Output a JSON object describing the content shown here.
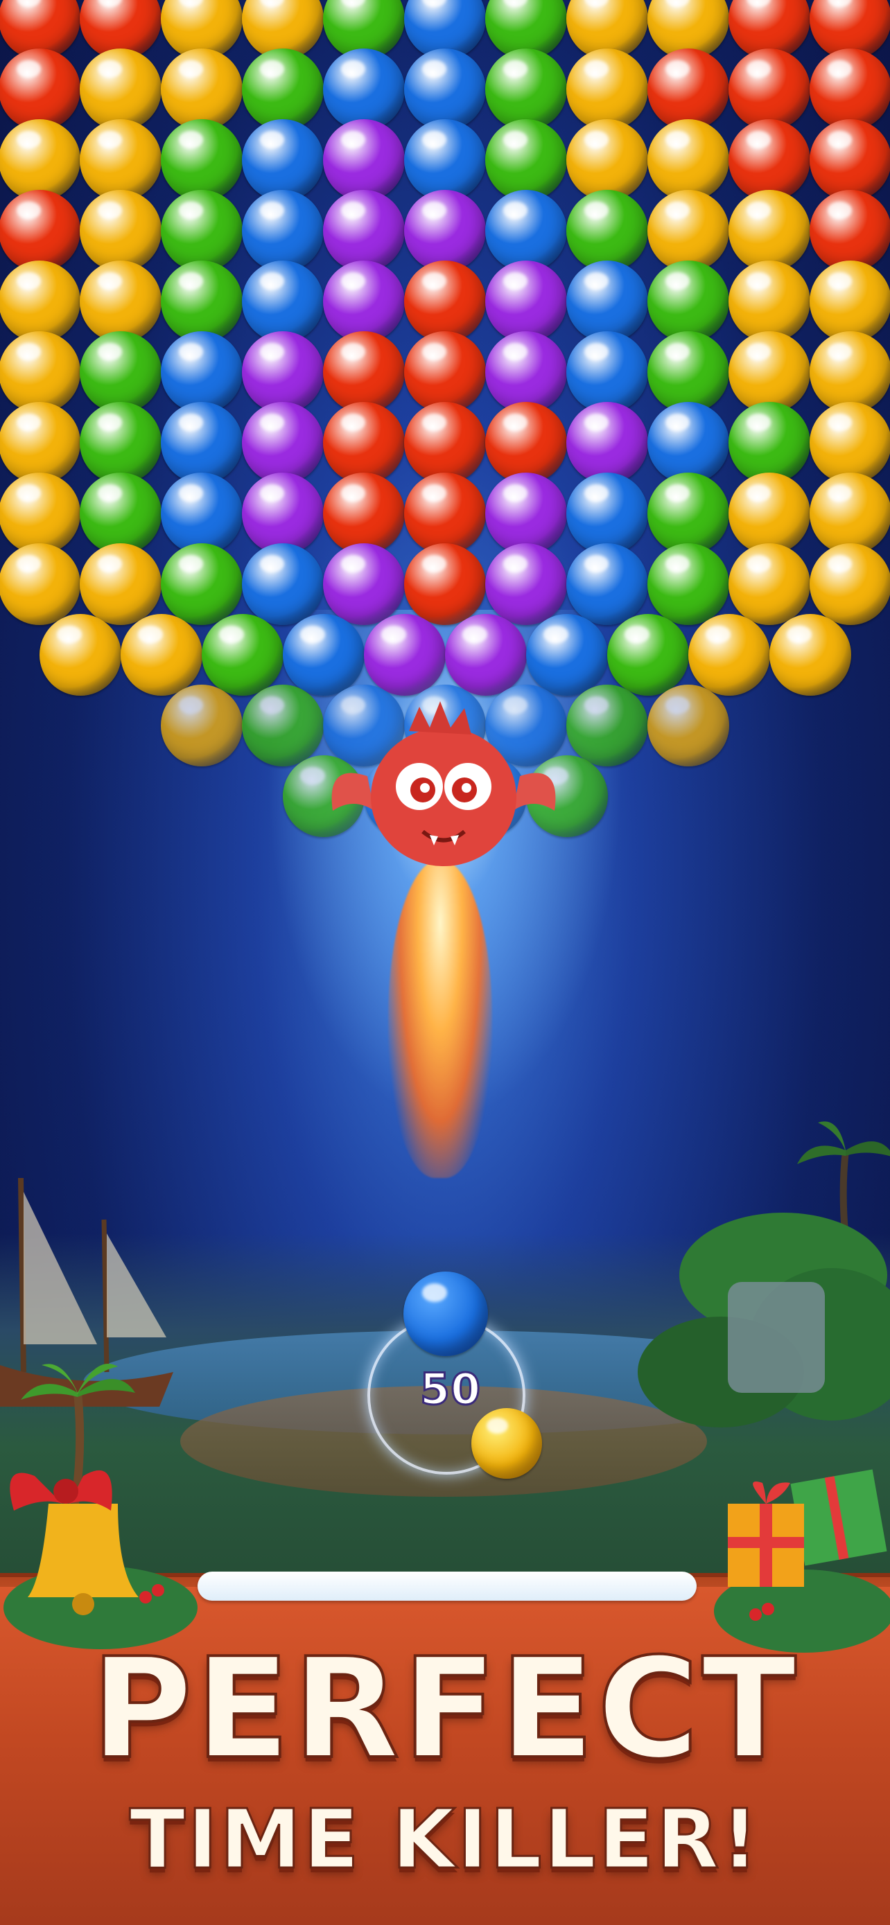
{
  "headline": {
    "line1": "PERFECT",
    "line2": "TIME KILLER!"
  },
  "shooter": {
    "shots_left": "50",
    "current_bubble_color": "blue",
    "next_bubble_color": "yellow"
  },
  "character": "red-dragon",
  "palette": {
    "red": "#e8320f",
    "yellow": "#f3b20a",
    "green": "#3cba14",
    "blue": "#1a6fe0",
    "purple": "#9a2be0",
    "banner": "#c94a22",
    "headline_text": "#fff8ea"
  },
  "bubble_grid": [
    [
      "red",
      "red",
      "yellow",
      "yellow",
      "green",
      "blue",
      "green",
      "yellow",
      "yellow",
      "red",
      "red"
    ],
    [
      "red",
      "yellow",
      "yellow",
      "green",
      "blue",
      "blue",
      "green",
      "yellow",
      "red",
      "red",
      "red"
    ],
    [
      "yellow",
      "yellow",
      "green",
      "blue",
      "purple",
      "blue",
      "green",
      "yellow",
      "yellow",
      "red",
      "red"
    ],
    [
      "red",
      "yellow",
      "green",
      "blue",
      "purple",
      "purple",
      "blue",
      "green",
      "yellow",
      "yellow",
      "red"
    ],
    [
      "yellow",
      "yellow",
      "green",
      "blue",
      "purple",
      "red",
      "purple",
      "blue",
      "green",
      "yellow",
      "yellow"
    ],
    [
      "yellow",
      "green",
      "blue",
      "purple",
      "red",
      "red",
      "purple",
      "blue",
      "green",
      "yellow",
      "yellow"
    ],
    [
      "yellow",
      "green",
      "blue",
      "purple",
      "red",
      "red",
      "red",
      "purple",
      "blue",
      "green",
      "yellow"
    ],
    [
      "yellow",
      "green",
      "blue",
      "purple",
      "red",
      "red",
      "purple",
      "blue",
      "green",
      "yellow",
      "yellow"
    ],
    [
      "yellow",
      "yellow",
      "green",
      "blue",
      "purple",
      "red",
      "purple",
      "blue",
      "green",
      "yellow",
      "yellow"
    ],
    [
      "yellow",
      "yellow",
      "green",
      "blue",
      "purple",
      "purple",
      "blue",
      "green",
      "yellow",
      "yellow"
    ],
    [
      "yellow",
      "green",
      "blue",
      "blue",
      "blue",
      "green",
      "yellow"
    ],
    [
      "green",
      "blue",
      "blue",
      "green"
    ]
  ]
}
